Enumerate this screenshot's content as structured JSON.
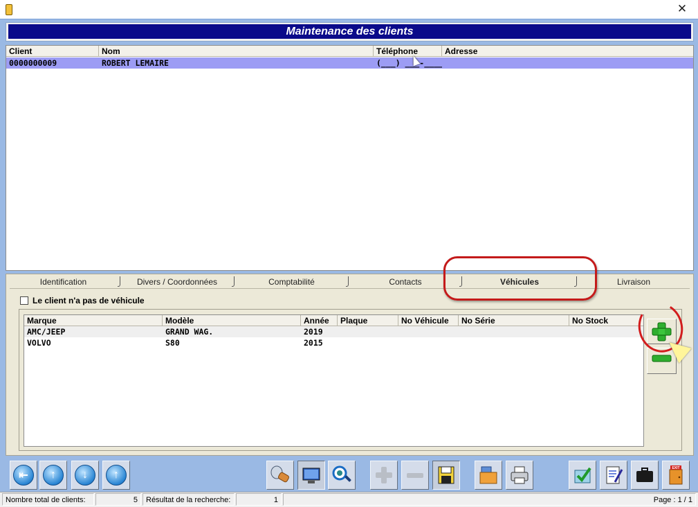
{
  "window": {
    "close_glyph": "✕"
  },
  "header": {
    "title": "Maintenance des clients"
  },
  "clients": {
    "columns": [
      "Client",
      "Nom",
      "Téléphone",
      "Adresse"
    ],
    "rows": [
      {
        "client": "0000000009",
        "nom": "ROBERT LEMAIRE",
        "telephone": "(___) ___-____",
        "adresse": ""
      }
    ]
  },
  "tabs": [
    {
      "label": "Identification"
    },
    {
      "label": "Divers / Coordonnées"
    },
    {
      "label": "Comptabilité"
    },
    {
      "label": "Contacts"
    },
    {
      "label": "Véhicules",
      "active": true
    },
    {
      "label": "Livraison"
    }
  ],
  "vehicles": {
    "no_vehicle_label": "Le client n'a pas de véhicule",
    "no_vehicle_checked": false,
    "columns": [
      "Marque",
      "Modèle",
      "Année",
      "Plaque",
      "No Véhicule",
      "No Série",
      "No Stock"
    ],
    "rows": [
      {
        "marque": "AMC/JEEP",
        "modele": "GRAND WAG.",
        "annee": "2019",
        "plaque": "",
        "no_vehicule": "",
        "no_serie": "",
        "no_stock": ""
      },
      {
        "marque": "VOLVO",
        "modele": "S80",
        "annee": "2015",
        "plaque": "",
        "no_vehicule": "",
        "no_serie": "",
        "no_stock": ""
      }
    ]
  },
  "toolbar": {
    "buttons": [
      {
        "icon": "first-record-icon"
      },
      {
        "icon": "previous-record-icon"
      },
      {
        "icon": "next-record-icon"
      },
      {
        "icon": "last-record-icon"
      },
      {
        "icon": "search-flashlight-icon"
      },
      {
        "icon": "screen-view-icon"
      },
      {
        "icon": "magnifier-icon"
      },
      {
        "icon": "add-icon"
      },
      {
        "icon": "remove-icon"
      },
      {
        "icon": "save-disk-icon"
      },
      {
        "icon": "open-folder-icon"
      },
      {
        "icon": "print-icon"
      },
      {
        "icon": "check-document-icon"
      },
      {
        "icon": "notes-icon"
      },
      {
        "icon": "briefcase-icon"
      },
      {
        "icon": "exit-door-icon"
      }
    ],
    "exit_sign": "EXIT"
  },
  "status": {
    "total_label": "Nombre total de clients:",
    "total_value": "5",
    "result_label": "Résultat de la recherche:",
    "result_value": "1",
    "page": "Page : 1 / 1"
  },
  "colors": {
    "banner": "#0a0a8a",
    "selected_row": "#9c9cf4",
    "highlight": "#c41a1a",
    "frame": "#9ab9e4"
  }
}
